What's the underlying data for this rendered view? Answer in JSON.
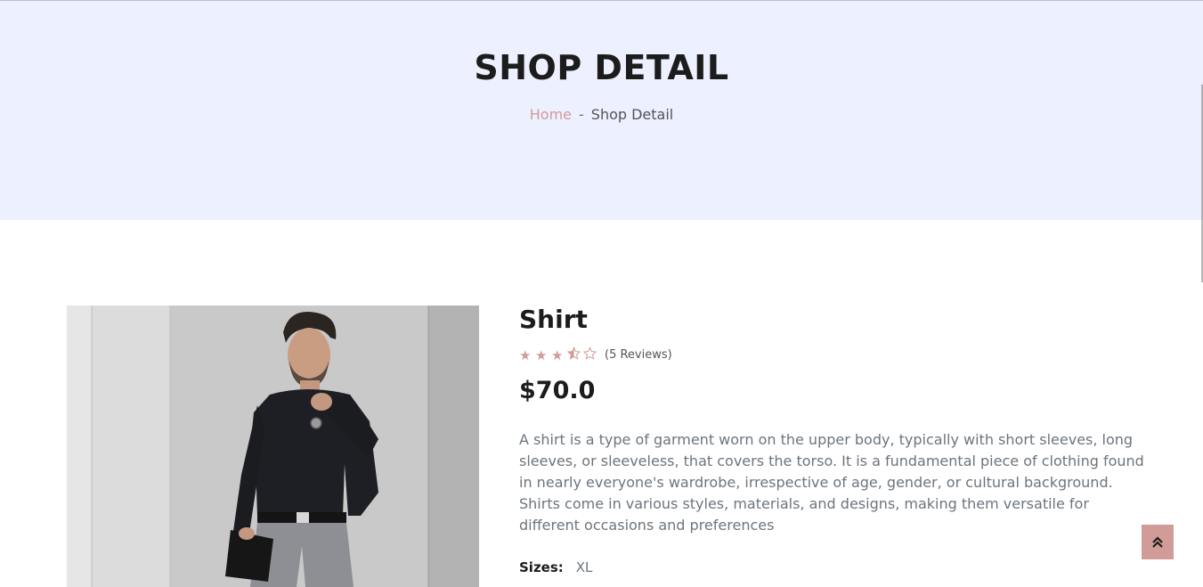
{
  "hero": {
    "title": "SHOP DETAIL",
    "breadcrumb": {
      "home": "Home",
      "separator": "-",
      "current": "Shop Detail"
    }
  },
  "product": {
    "name": "Shirt",
    "rating": 3.5,
    "rating_max": 5,
    "reviews": "(5 Reviews)",
    "price": "$70.0",
    "description": "A shirt is a type of garment worn on the upper body, typically with short sleeves, long sleeves, or sleeveless, that covers the torso. It is a fundamental piece of clothing found in nearly everyone's wardrobe, irrespective of age, gender, or cultural background. Shirts come in various styles, materials, and designs, making them versatile for different occasions and preferences",
    "sizes_label": "Sizes:",
    "sizes_value": "XL"
  },
  "colors": {
    "accent": "#d19c97",
    "hero_bg": "#edf0fe",
    "text_dark": "#1c1c1c",
    "text_muted": "#6c757d"
  },
  "icons": {
    "back_to_top": "double-chevron-up-icon",
    "star_full": "star-icon",
    "star_half": "star-half-icon",
    "star_empty": "star-outline-icon"
  }
}
